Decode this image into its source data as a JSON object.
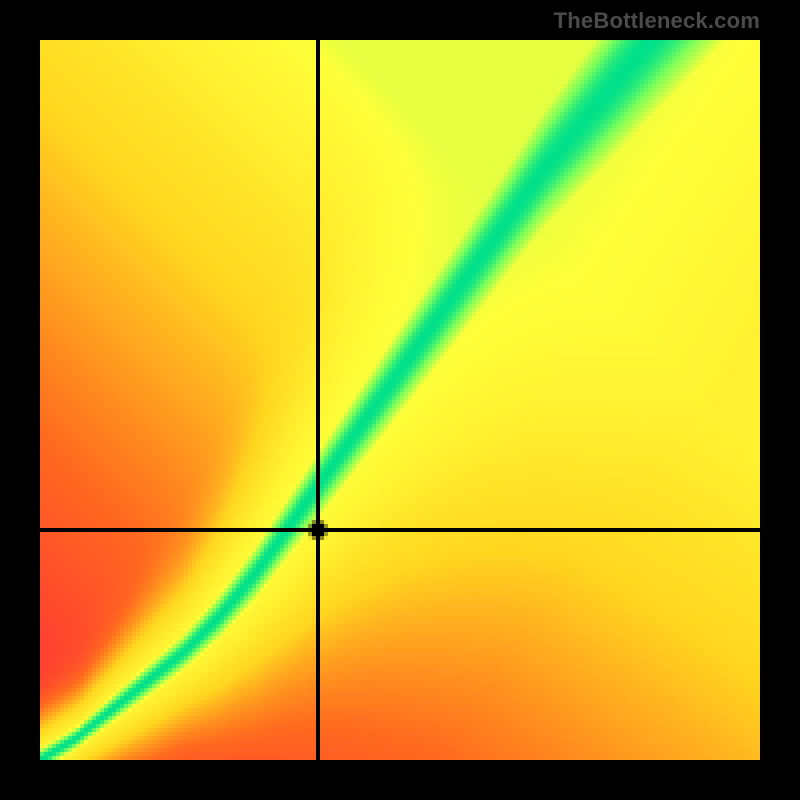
{
  "watermark": "TheBottleneck.com",
  "chart_data": {
    "type": "heatmap",
    "title": "",
    "xlabel": "",
    "ylabel": "",
    "xlim": [
      0,
      1
    ],
    "ylim": [
      0,
      1
    ],
    "crosshair": {
      "x": 0.385,
      "y": 0.325
    },
    "ridge": [
      {
        "x": 0.0,
        "y": 0.0,
        "width": 0.01
      },
      {
        "x": 0.05,
        "y": 0.03,
        "width": 0.012
      },
      {
        "x": 0.1,
        "y": 0.07,
        "width": 0.015
      },
      {
        "x": 0.15,
        "y": 0.11,
        "width": 0.018
      },
      {
        "x": 0.2,
        "y": 0.15,
        "width": 0.02
      },
      {
        "x": 0.25,
        "y": 0.2,
        "width": 0.025
      },
      {
        "x": 0.3,
        "y": 0.26,
        "width": 0.03
      },
      {
        "x": 0.35,
        "y": 0.33,
        "width": 0.035
      },
      {
        "x": 0.4,
        "y": 0.4,
        "width": 0.04
      },
      {
        "x": 0.45,
        "y": 0.47,
        "width": 0.045
      },
      {
        "x": 0.5,
        "y": 0.54,
        "width": 0.05
      },
      {
        "x": 0.55,
        "y": 0.61,
        "width": 0.055
      },
      {
        "x": 0.6,
        "y": 0.68,
        "width": 0.06
      },
      {
        "x": 0.65,
        "y": 0.75,
        "width": 0.065
      },
      {
        "x": 0.7,
        "y": 0.82,
        "width": 0.072
      },
      {
        "x": 0.75,
        "y": 0.88,
        "width": 0.08
      },
      {
        "x": 0.8,
        "y": 0.94,
        "width": 0.088
      },
      {
        "x": 0.85,
        "y": 1.0,
        "width": 0.095
      }
    ],
    "colormap": [
      {
        "t": 0.0,
        "color": "#ff2a3a"
      },
      {
        "t": 0.25,
        "color": "#ff6a1f"
      },
      {
        "t": 0.5,
        "color": "#ffd61f"
      },
      {
        "t": 0.75,
        "color": "#ffff3a"
      },
      {
        "t": 0.9,
        "color": "#7eff5a"
      },
      {
        "t": 1.0,
        "color": "#00e08a"
      }
    ],
    "background_field_notes": "Background warmth increases toward the upper-right (roughly proportional to x+y), overlaid with a green diagonal ridge that curves slightly.",
    "marker": {
      "x": 0.385,
      "y": 0.325,
      "radius_px": 5
    }
  }
}
